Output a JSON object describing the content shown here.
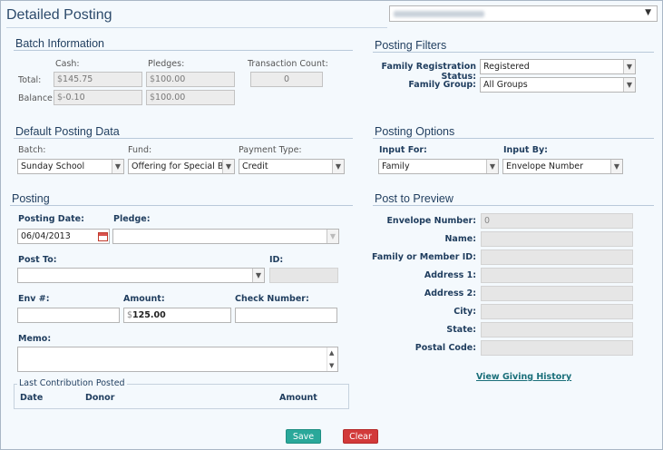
{
  "page": {
    "title": "Detailed Posting"
  },
  "batch_info": {
    "heading": "Batch Information",
    "col_cash": "Cash:",
    "col_pledges": "Pledges:",
    "col_txn": "Transaction Count:",
    "row_total": "Total:",
    "row_balance": "Balance:",
    "currency": "$",
    "total_cash": "145.75",
    "total_pledges": "100.00",
    "txn_count": "0",
    "balance_cash": "-0.10",
    "balance_pledges": "100.00"
  },
  "posting_filters": {
    "heading": "Posting Filters",
    "family_status_label": "Family Registration Status:",
    "family_status_value": "Registered",
    "family_group_label": "Family Group:",
    "family_group_value": "All Groups"
  },
  "default_posting": {
    "heading": "Default Posting Data",
    "batch_label": "Batch:",
    "batch_value": "Sunday School",
    "fund_label": "Fund:",
    "fund_value": "Offering for Special Bless",
    "payment_label": "Payment Type:",
    "payment_value": "Credit"
  },
  "posting_options": {
    "heading": "Posting Options",
    "input_for_label": "Input For:",
    "input_for_value": "Family",
    "input_by_label": "Input By:",
    "input_by_value": "Envelope Number"
  },
  "posting": {
    "heading": "Posting",
    "date_label": "Posting Date:",
    "date_value": "06/04/2013",
    "pledge_label": "Pledge:",
    "post_to_label": "Post To:",
    "id_label": "ID:",
    "env_label": "Env #:",
    "amount_label": "Amount:",
    "amount_value": "125.00",
    "check_label": "Check Number:",
    "memo_label": "Memo:"
  },
  "last_contribution": {
    "legend": "Last Contribution Posted",
    "col_date": "Date",
    "col_donor": "Donor",
    "col_amount": "Amount"
  },
  "preview": {
    "heading": "Post to Preview",
    "envelope_label": "Envelope Number:",
    "envelope_value": "0",
    "name_label": "Name:",
    "family_id_label": "Family or Member ID:",
    "address1_label": "Address 1:",
    "address2_label": "Address 2:",
    "city_label": "City:",
    "state_label": "State:",
    "postal_label": "Postal Code:",
    "history_link": "View Giving History"
  },
  "actions": {
    "save": "Save",
    "clear": "Clear"
  },
  "colors": {
    "save": "#2aa89a",
    "clear": "#d23a3a",
    "heading": "#1f3d5e"
  }
}
